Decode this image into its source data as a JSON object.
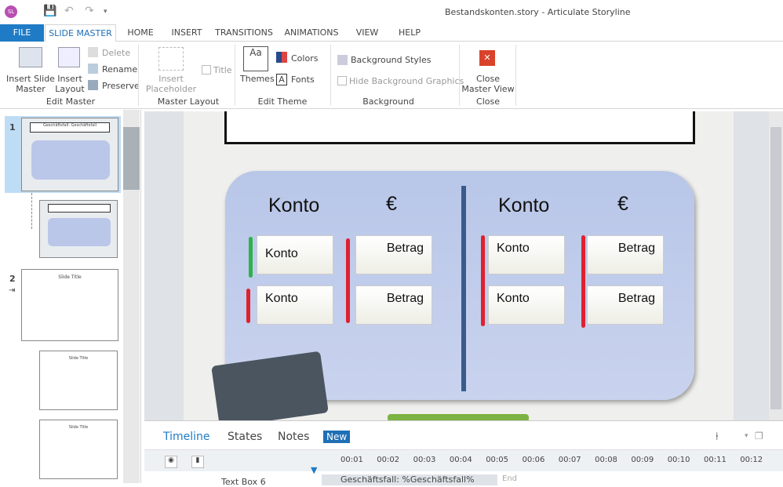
{
  "app": {
    "logo": "SL",
    "title": "Bestandskonten.story - Articulate Storyline"
  },
  "tabs": [
    "FILE",
    "SLIDE MASTER",
    "HOME",
    "INSERT",
    "TRANSITIONS",
    "ANIMATIONS",
    "VIEW",
    "HELP"
  ],
  "ribbon": {
    "insert_slide_master": "Insert Slide Master",
    "insert_layout": "Insert Layout",
    "delete": "Delete",
    "rename": "Rename",
    "preserve": "Preserve",
    "edit_master": "Edit Master",
    "insert_placeholder": "Insert Placeholder",
    "title": "Title",
    "master_layout": "Master Layout",
    "themes": "Themes",
    "colors": "Colors",
    "fonts": "Fonts",
    "edit_theme": "Edit Theme",
    "background_styles": "Background Styles",
    "hide_background_graphics": "Hide Background Graphics",
    "background": "Background",
    "close_master_view": "Close Master View",
    "close": "Close"
  },
  "left": {
    "items": [
      {
        "num": "1",
        "title": "Geschäftsfall: Geschäftsfall"
      },
      {
        "num": "2",
        "title": "Slide Title"
      }
    ],
    "sub_title": "Slide Title"
  },
  "slide": {
    "headers": [
      "Konto",
      "€",
      "Konto",
      "€"
    ],
    "cards": [
      "Konto",
      "Betrag",
      "Konto",
      "Betrag",
      "Konto",
      "Betrag",
      "Konto",
      "Betrag"
    ]
  },
  "timeline": {
    "tabs": [
      "Timeline",
      "States",
      "Notes"
    ],
    "badge": "New",
    "ticks": [
      "00:01",
      "00:02",
      "00:03",
      "00:04",
      "00:05",
      "00:06",
      "00:07",
      "00:08",
      "00:09",
      "00:10",
      "00:11",
      "00:12"
    ],
    "row_name": "Text Box 6",
    "row_text": "Geschäftsfall: %Geschäftsfall%",
    "end": "End"
  },
  "colors": {
    "accent": "#1f7bc6",
    "green": "#2db24a",
    "red": "#e0202e"
  }
}
